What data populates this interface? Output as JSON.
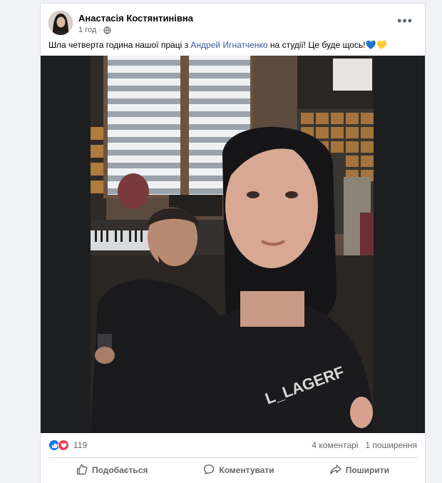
{
  "post": {
    "author": "Анастасія Костянтинівна",
    "time": "1 год",
    "separator": "·",
    "text_before": "Шла четверта година нашої праці з ",
    "mention": "Андрей Игнатченко",
    "text_after": " на студії! Це буде щось!💙💛"
  },
  "stats": {
    "reaction_count": "119",
    "comments": "4 коментарі",
    "shares": "1 поширення"
  },
  "actions": {
    "like": "Подобається",
    "comment": "Коментувати",
    "share": "Поширити"
  },
  "colors": {
    "mention": "#385898",
    "like_blue": "#1877f2",
    "love_red": "#f33e58",
    "secondary_text": "#65676b"
  }
}
